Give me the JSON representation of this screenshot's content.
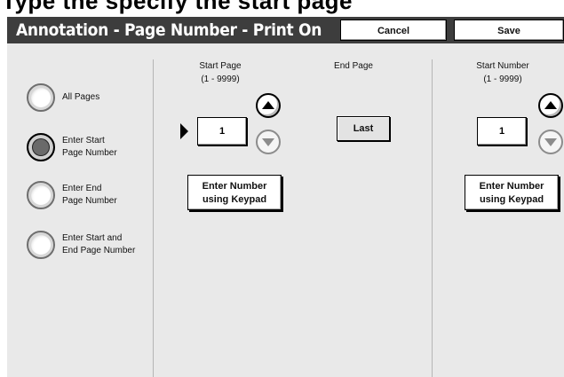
{
  "top_strip_text": "Type  the  specify  the  start  page",
  "header": {
    "title": "Annotation - Page Number - Print On",
    "cancel_label": "Cancel",
    "save_label": "Save"
  },
  "radios": [
    {
      "label": "All Pages",
      "selected": false
    },
    {
      "label": "Enter Start\nPage Number",
      "selected": true
    },
    {
      "label": "Enter End\nPage Number",
      "selected": false
    },
    {
      "label": "Enter Start and\nEnd Page Number",
      "selected": false
    }
  ],
  "start_page": {
    "label": "Start Page\n(1 - 9999)",
    "value": "1",
    "keypad_label": "Enter Number\nusing Keypad"
  },
  "end_page": {
    "label": "End Page",
    "value": "Last"
  },
  "start_number": {
    "label": "Start Number\n(1 - 9999)",
    "value": "1",
    "keypad_label": "Enter Number\nusing Keypad"
  }
}
